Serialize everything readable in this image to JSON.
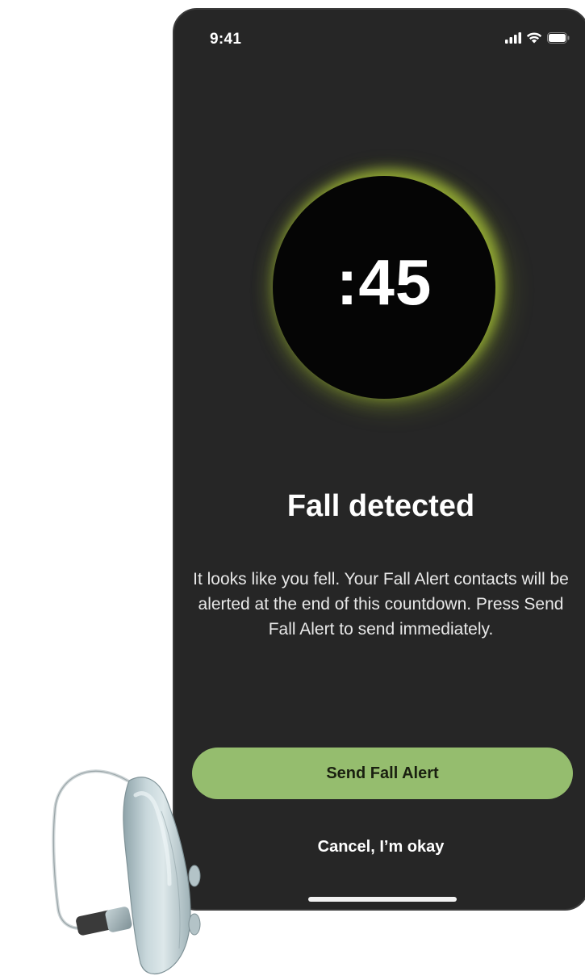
{
  "status_bar": {
    "time": "9:41",
    "icons": [
      "cellular-signal-icon",
      "wifi-icon",
      "battery-icon"
    ]
  },
  "countdown": {
    "value": ":45",
    "ring_glow_color": "#b8d63a",
    "circle_color": "#050505"
  },
  "alert": {
    "title": "Fall detected",
    "message": "It looks like you fell. Your Fall Alert contacts will be alerted at the end of this countdown. Press Send Fall Alert to send immediately."
  },
  "actions": {
    "send_label": "Send Fall Alert",
    "cancel_label": "Cancel, I’m okay"
  },
  "colors": {
    "screen_background": "#262626",
    "primary_button": "#95bd6e",
    "page_background": "#ffffff"
  },
  "illustration": {
    "icon": "hearing-aid-icon"
  }
}
